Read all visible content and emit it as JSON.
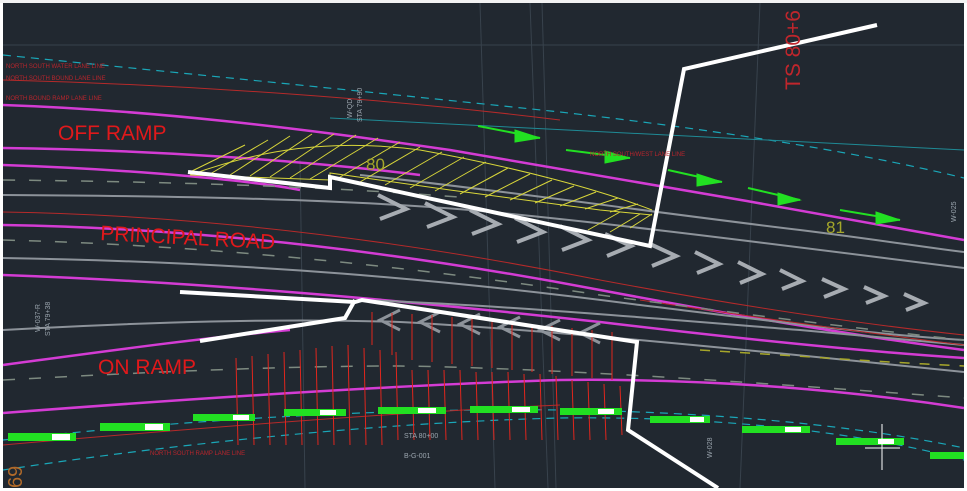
{
  "labels": {
    "off_ramp": "OFF RAMP",
    "principal_road": "PRINCIPAL ROAD",
    "on_ramp": "ON RAMP"
  },
  "stations": {
    "sta_80_marker": "80",
    "sta_81_marker": "81",
    "ts_label": "TS 80+6",
    "left_edge_number": "69",
    "sta_80_00": "STA 80+00",
    "sheet_ref": "B-G-001",
    "w_qd": "W-QD",
    "sta_79_90": "STA 79+90",
    "w_037_r": "W-037-R",
    "sta_79_38": "STA 79+38",
    "w_025": "W-025",
    "w_028": "W-028"
  },
  "small_red_notes": [
    "NORTH SOUTH WATER LANE LINE",
    "NORTH SOUTH BOUND LANE LINE",
    "NORTH BOUND RAMP LANE LINE",
    "NORTH SOUTH/WEST LANE LINE",
    "NORTH SOUTH RAMP LANE LINE"
  ],
  "colors": {
    "background": "#212830",
    "frame": "#f2f2f2",
    "label_red": "#e0191b",
    "magenta_edge": "#d43cd4",
    "yellow_hatch": "#d8d63a",
    "red_hatch": "#e0261d",
    "green_arrow": "#22e022",
    "cyan_dash": "#1aa7b8",
    "cut_line": "#ffffff"
  }
}
